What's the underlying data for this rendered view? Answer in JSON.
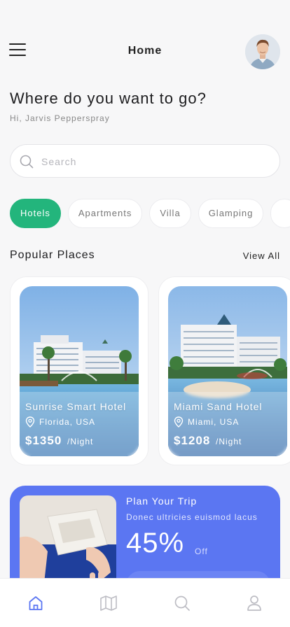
{
  "header": {
    "title": "Home"
  },
  "greeting": {
    "heading": "Where do you want to go?",
    "subtitle": "Hi, Jarvis Pepperspray"
  },
  "search": {
    "placeholder": "Search",
    "value": ""
  },
  "categories": [
    {
      "label": "Hotels",
      "active": true
    },
    {
      "label": "Apartments",
      "active": false
    },
    {
      "label": "Villa",
      "active": false
    },
    {
      "label": "Glamping",
      "active": false
    }
  ],
  "popular": {
    "title": "Popular Places",
    "view_all": "View All",
    "places": [
      {
        "name": "Sunrise Smart Hotel",
        "location": "Florida, USA",
        "price": "$1350",
        "unit": "/Night"
      },
      {
        "name": "Miami Sand Hotel",
        "location": "Miami, USA",
        "price": "$1208",
        "unit": "/Night"
      }
    ]
  },
  "promo": {
    "title": "Plan Your Trip",
    "subtitle": "Donec ultricies euismod lacus",
    "percent": "45%",
    "off": "Off"
  },
  "tabs": [
    {
      "icon": "home-icon",
      "active": true
    },
    {
      "icon": "map-icon",
      "active": false
    },
    {
      "icon": "search-icon",
      "active": false
    },
    {
      "icon": "profile-icon",
      "active": false
    }
  ],
  "colors": {
    "accent_green": "#23b57c",
    "promo_blue": "#5b76f2",
    "tab_active": "#5b76f2",
    "tab_inactive": "#bdbdc4"
  }
}
